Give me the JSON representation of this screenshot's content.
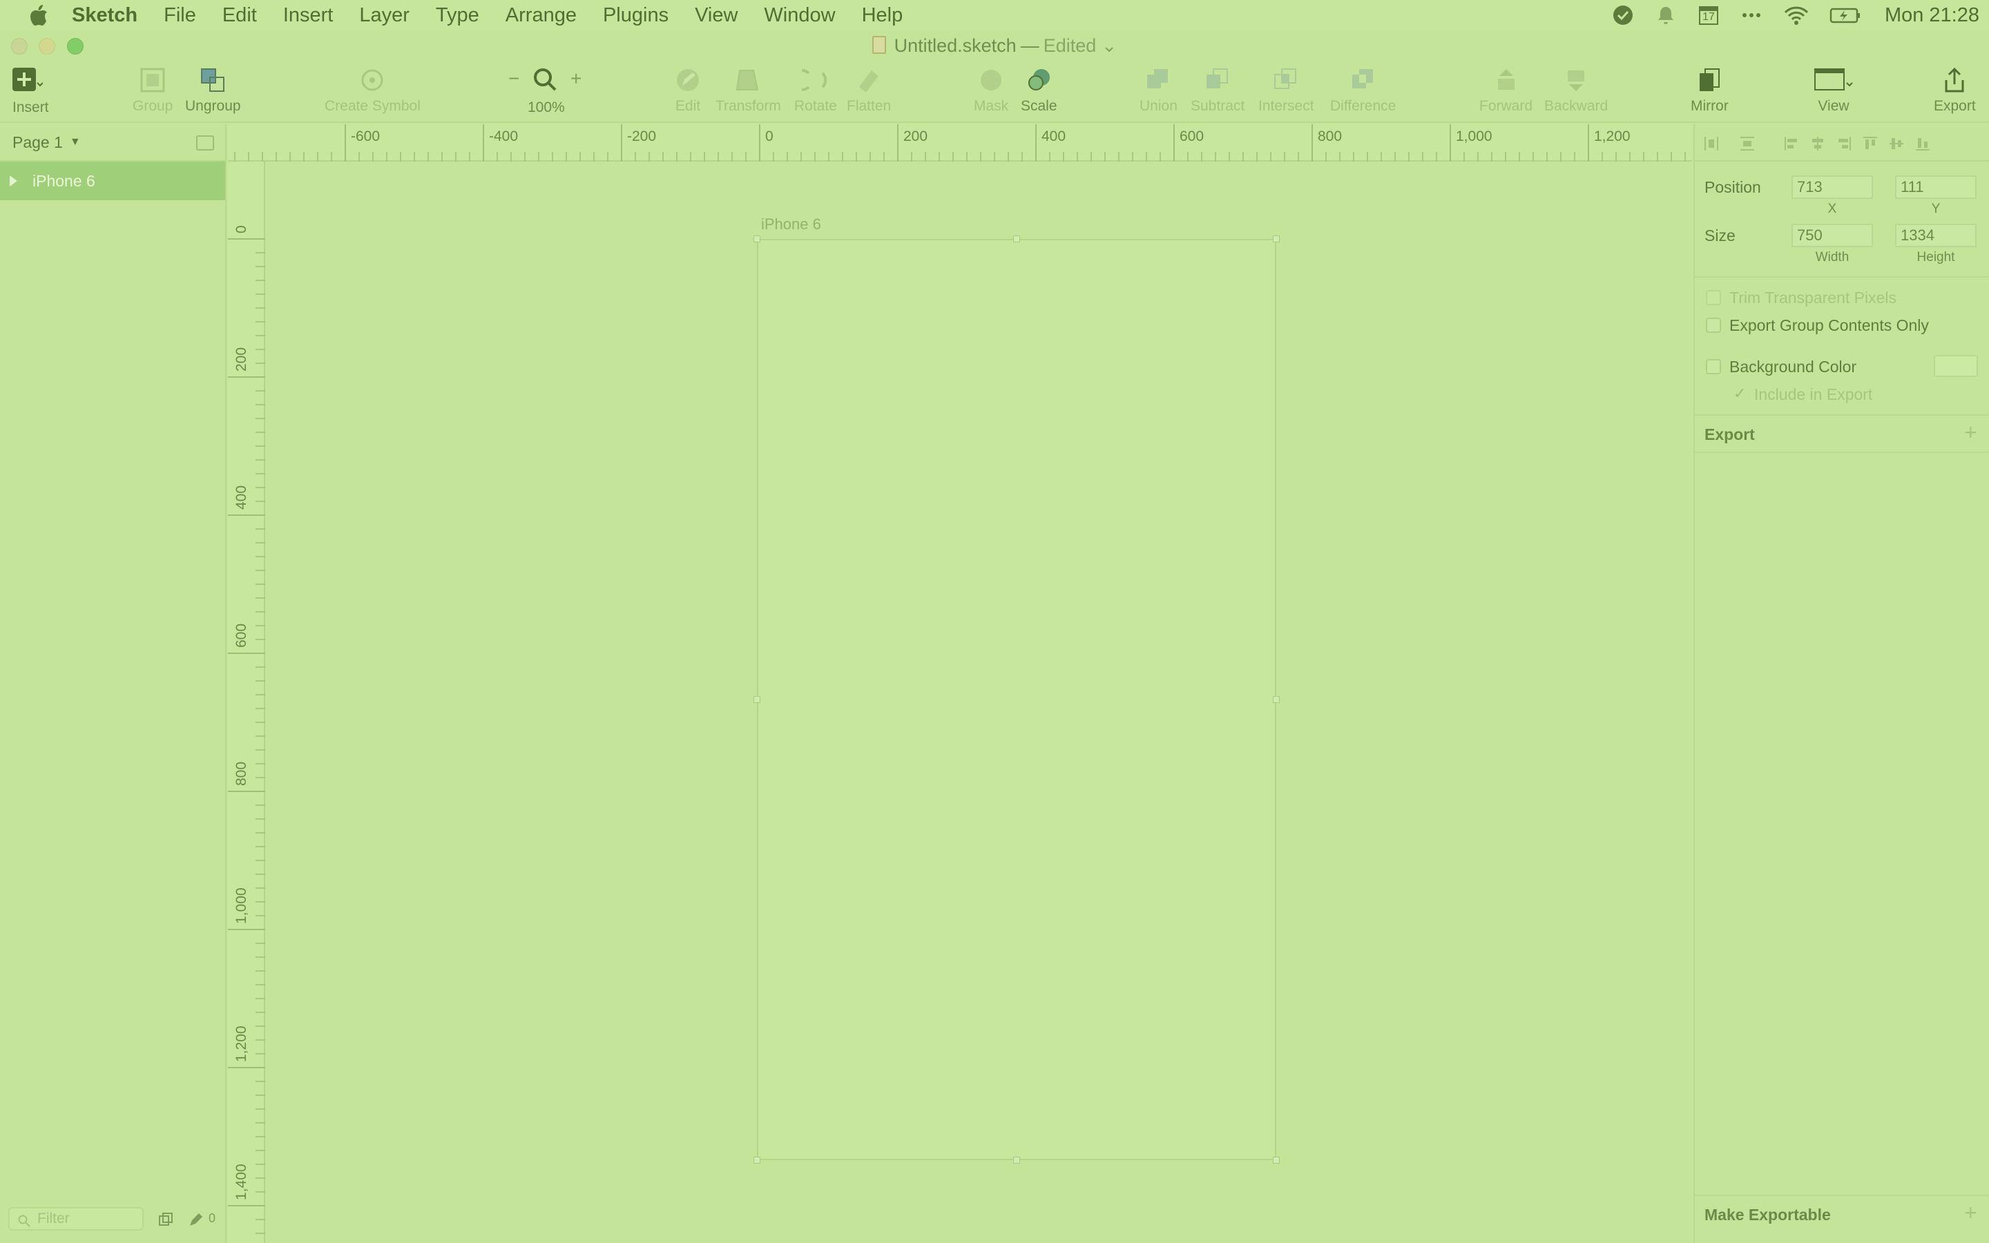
{
  "menubar": {
    "app_name": "Sketch",
    "items": [
      "File",
      "Edit",
      "Insert",
      "Layer",
      "Type",
      "Arrange",
      "Plugins",
      "View",
      "Window",
      "Help"
    ],
    "calendar_day": "17",
    "clock": "Mon 21:28"
  },
  "window": {
    "doc_title": "Untitled.sketch",
    "separator": "—",
    "doc_status": "Edited"
  },
  "toolbar": {
    "insert": "Insert",
    "group": "Group",
    "ungroup": "Ungroup",
    "create_symbol": "Create Symbol",
    "zoom_minus": "−",
    "zoom_plus": "+",
    "zoom_level": "100%",
    "edit": "Edit",
    "transform": "Transform",
    "rotate": "Rotate",
    "flatten": "Flatten",
    "mask": "Mask",
    "scale": "Scale",
    "union": "Union",
    "subtract": "Subtract",
    "intersect": "Intersect",
    "difference": "Difference",
    "forward": "Forward",
    "backward": "Backward",
    "mirror": "Mirror",
    "view": "View",
    "export": "Export"
  },
  "layers": {
    "page_name": "Page 1",
    "items": [
      {
        "label": "iPhone 6"
      }
    ],
    "filter_placeholder": "Filter",
    "edited_count": "0"
  },
  "rulers": {
    "top_labels": [
      "-600",
      "-400",
      "-200",
      "0",
      "200",
      "400",
      "600",
      "800",
      "1,000",
      "1,200"
    ],
    "left_labels": [
      "0",
      "200",
      "400",
      "600",
      "800",
      "1,000",
      "1,200",
      "1,400"
    ]
  },
  "canvas": {
    "artboard_name": "iPhone 6"
  },
  "inspector": {
    "position_label": "Position",
    "x_value": "713",
    "y_value": "111",
    "x_label": "X",
    "y_label": "Y",
    "size_label": "Size",
    "width_value": "750",
    "height_value": "1334",
    "width_label": "Width",
    "height_label": "Height",
    "trim_label": "Trim Transparent Pixels",
    "export_group_label": "Export Group Contents Only",
    "bg_color_label": "Background Color",
    "include_label": "Include in Export",
    "export_header": "Export",
    "make_exportable": "Make Exportable"
  }
}
